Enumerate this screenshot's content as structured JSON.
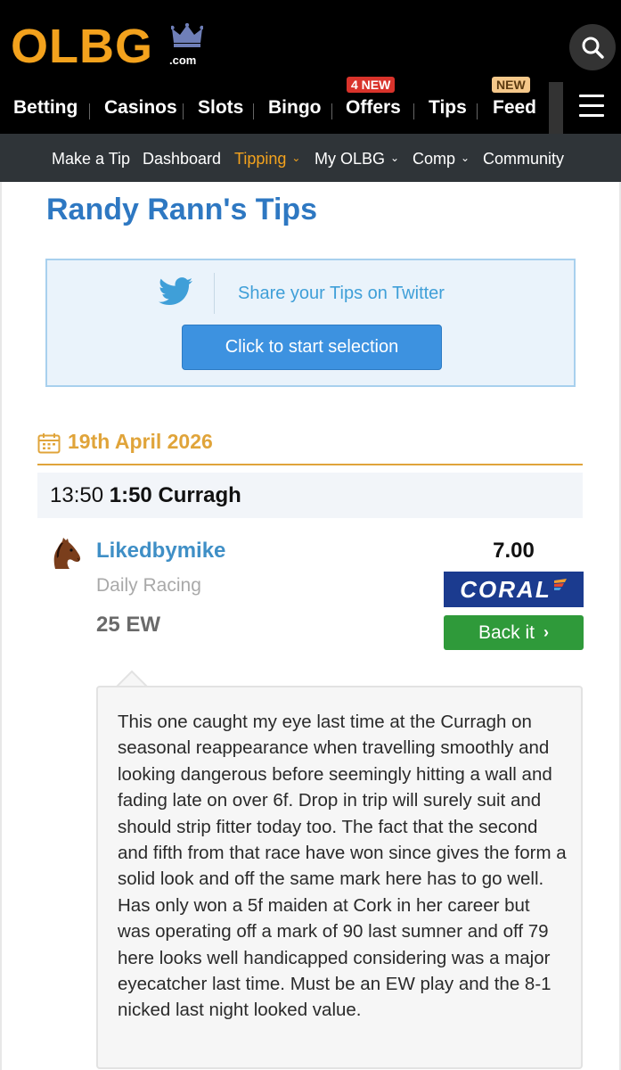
{
  "header": {
    "logo_text": "OLBG",
    "logo_suffix": ".com",
    "nav": [
      {
        "label": "Betting"
      },
      {
        "label": "Casinos"
      },
      {
        "label": "Slots"
      },
      {
        "label": "Bingo"
      },
      {
        "label": "Offers",
        "badge": "4 NEW"
      },
      {
        "label": "Tips"
      },
      {
        "label": "Feed",
        "badge": "NEW"
      }
    ],
    "icons": {
      "search": "search-icon",
      "menu": "hamburger-menu-icon",
      "logo": "crown-icon"
    }
  },
  "subnav": [
    {
      "label": "Make a Tip",
      "dropdown": false,
      "active": false
    },
    {
      "label": "Dashboard",
      "dropdown": false,
      "active": false
    },
    {
      "label": "Tipping",
      "dropdown": true,
      "active": true
    },
    {
      "label": "My OLBG",
      "dropdown": true,
      "active": false
    },
    {
      "label": "Comp",
      "dropdown": true,
      "active": false
    },
    {
      "label": "Community",
      "dropdown": false,
      "active": false
    }
  ],
  "page": {
    "title": "Randy Rann's Tips",
    "share": {
      "text": "Share your Tips on Twitter",
      "button": "Click to start selection"
    },
    "date": "19th April 2026",
    "race": {
      "time": "13:50",
      "name": "1:50 Curragh"
    },
    "tip": {
      "selection": "Likedbymike",
      "category": "Daily Racing",
      "stake": "25 EW",
      "odds": "7.00",
      "bookmaker": "CORAL",
      "back_button": "Back it",
      "comment": "This one caught my eye last time at the Curragh on seasonal reappearance when travelling smoothly and looking dangerous before seemingly hitting a wall and fading late on over 6f. Drop in trip will surely suit and should strip fitter today too. The fact that the second and fifth from that race have won since gives the form a solid look and off the same mark here has to go well. Has only won a 5f maiden at Cork in her career but was operating off a mark of 90 last sumner and off 79 here looks well handicapped considering was a major eyecatcher last time. Must be an EW play and the 8-1 nicked last night looked value."
    }
  },
  "colors": {
    "brand_orange": "#f3a21d",
    "title_blue": "#2e78c2",
    "link_blue": "#3f8fc6",
    "back_green": "#2f9a3a",
    "coral_navy": "#1b3b8f",
    "badge_red": "#d9332b"
  }
}
